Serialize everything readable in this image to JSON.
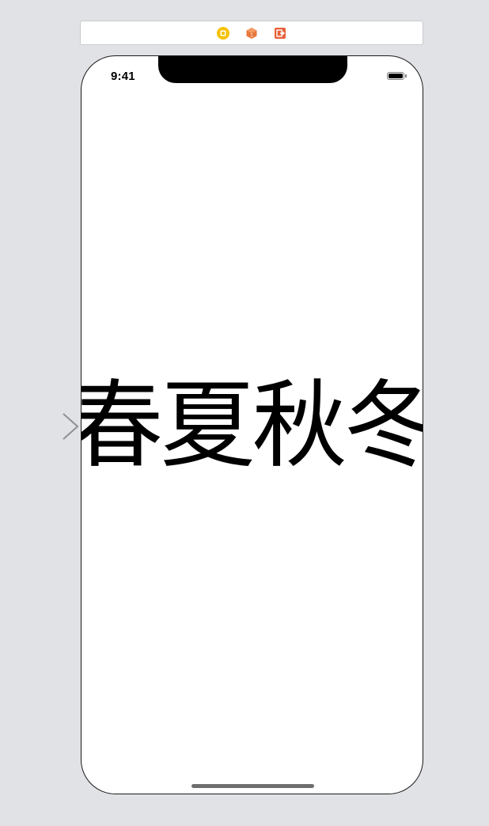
{
  "dock": {
    "icons": [
      "view-controller-icon",
      "first-responder-icon",
      "exit-icon"
    ],
    "colors": {
      "view_controller": "#f5c200",
      "first_responder": "#e8773a",
      "exit": "#e8603a"
    }
  },
  "status_bar": {
    "time": "9:41",
    "battery_level": 1.0
  },
  "main": {
    "label_text": "春夏秋冬"
  },
  "entry_point": {
    "icon": "entry-arrow-icon"
  },
  "colors": {
    "canvas": "#e1e2e6",
    "device_bg": "#ffffff",
    "text": "#000000"
  }
}
